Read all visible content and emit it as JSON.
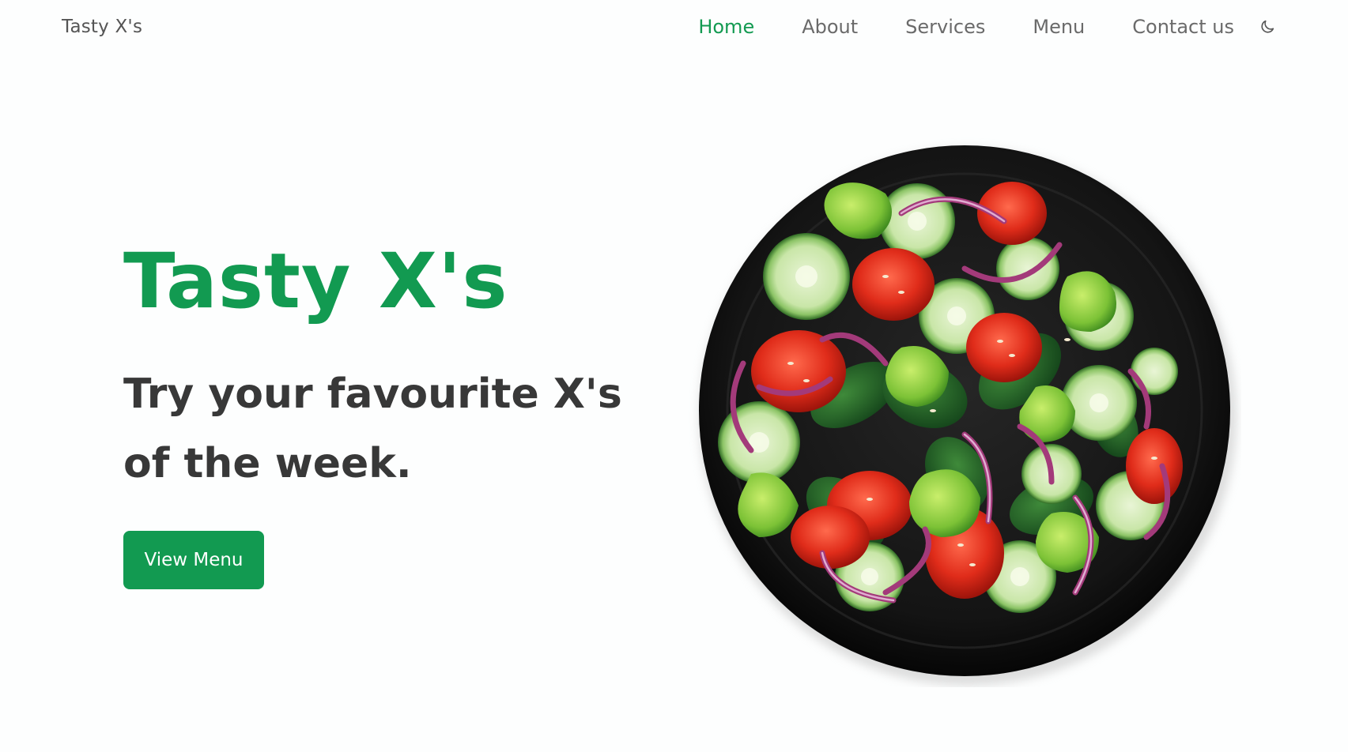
{
  "header": {
    "brand": "Tasty X's",
    "nav": [
      {
        "label": "Home",
        "active": true
      },
      {
        "label": "About",
        "active": false
      },
      {
        "label": "Services",
        "active": false
      },
      {
        "label": "Menu",
        "active": false
      },
      {
        "label": "Contact us",
        "active": false
      }
    ],
    "theme_toggle_icon": "moon-icon"
  },
  "hero": {
    "title": "Tasty X's",
    "subtitle": "Try your favourite X's of the week.",
    "cta_label": "View Menu",
    "image_icon": "salad-plate-image"
  },
  "colors": {
    "accent": "#129a51",
    "text_dark": "#383838",
    "nav_text": "#6a6a6a",
    "background": "#fdfefe"
  }
}
